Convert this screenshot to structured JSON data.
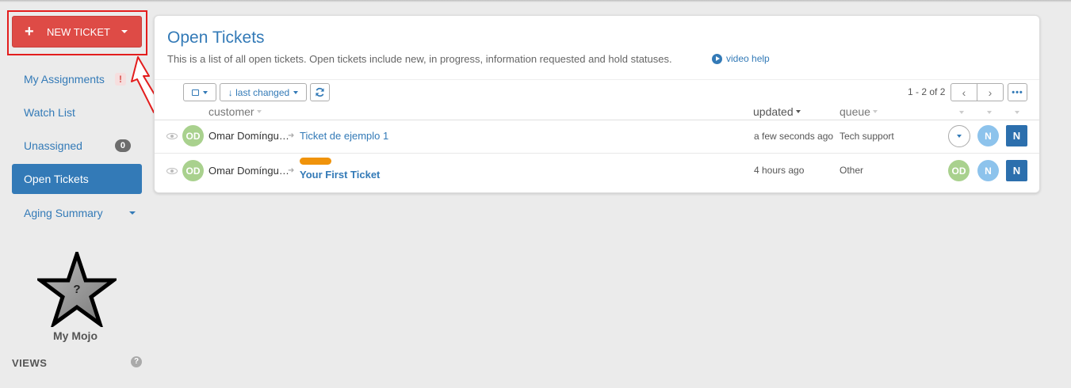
{
  "sidebar": {
    "new_ticket_label": "NEW TICKET",
    "items": [
      {
        "label": "My Assignments",
        "indicator": "!"
      },
      {
        "label": "Watch List"
      },
      {
        "label": "Unassigned",
        "badge": "0"
      },
      {
        "label": "Open Tickets",
        "active": true
      },
      {
        "label": "Aging Summary"
      }
    ],
    "mojo_star_glyph": "?",
    "mojo_label": "My Mojo",
    "views_label": "VIEWS",
    "views_help_glyph": "?"
  },
  "main": {
    "title": "Open Tickets",
    "description": "This is a list of all open tickets. Open tickets include new, in progress, information requested and hold statuses.",
    "video_help_label": "video help",
    "toolbar": {
      "sort_label": "↓ last changed",
      "paging_text": "1 - 2 of 2"
    },
    "columns": {
      "customer": "customer",
      "updated": "updated",
      "queue": "queue"
    },
    "rows": [
      {
        "avatar": "OD",
        "customer": "Omar Domíngu…",
        "title": "Ticket de ejemplo 1",
        "updated": "a few seconds ago",
        "queue": "Tech support",
        "assignee_initial": "N",
        "agent_initial": "N"
      },
      {
        "avatar": "OD",
        "customer": "Omar Domíngu…",
        "title": "Your First Ticket",
        "updated": "4 hours ago",
        "queue": "Other",
        "owner_avatar": "OD",
        "assignee_initial": "N",
        "agent_initial": "N"
      }
    ]
  },
  "colors": {
    "new_ticket_bg": "#de4b46",
    "link_blue": "#337ab7",
    "highlight_red": "#e31d1d",
    "tag_orange": "#f0930b",
    "avatar_green": "#a9d18e",
    "avatar_blue": "#8dc3ec",
    "agent_square": "#2c6fad"
  }
}
